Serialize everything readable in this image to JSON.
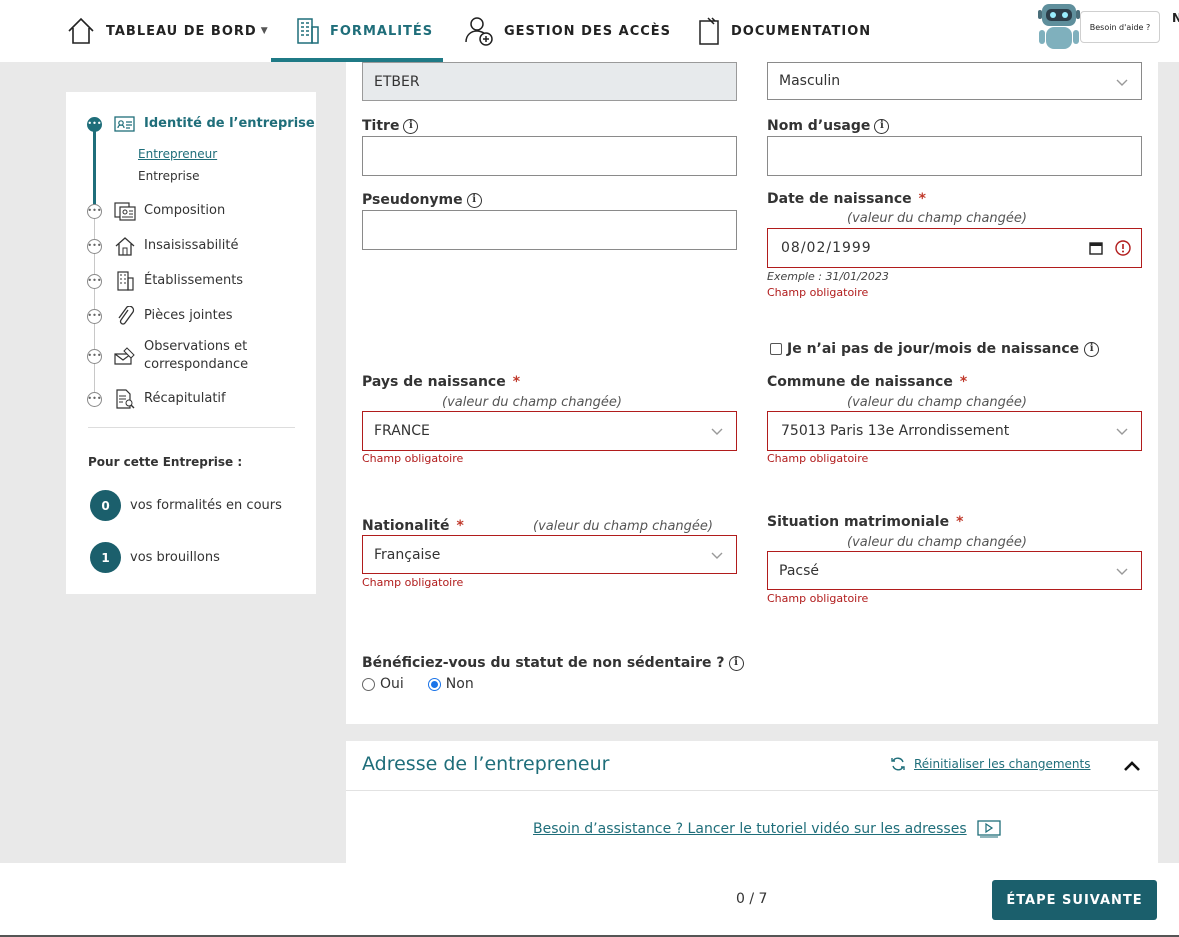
{
  "nav": {
    "items": [
      {
        "label": "TABLEAU DE BORD",
        "icon": "home-icon"
      },
      {
        "label": "FORMALITÉS",
        "icon": "building-icon",
        "active": true
      },
      {
        "label": "GESTION DES ACCÈS",
        "icon": "user-add-icon"
      },
      {
        "label": "DOCUMENTATION",
        "icon": "document-icon"
      }
    ],
    "help_label": "Besoin d'aide ?",
    "user_initial": "N"
  },
  "sidebar": {
    "steps": [
      {
        "label": "Identité de l’entreprise",
        "icon": "id-card-icon",
        "active": true
      },
      {
        "label": "Composition",
        "icon": "composition-icon"
      },
      {
        "label": "Insaisissabilité",
        "icon": "house-icon"
      },
      {
        "label": "Établissements",
        "icon": "establishment-icon"
      },
      {
        "label": "Pièces jointes",
        "icon": "paperclip-icon"
      },
      {
        "label": "Observations et correspondance",
        "icon": "envelope-icon"
      },
      {
        "label": "Récapitulatif",
        "icon": "summary-icon"
      }
    ],
    "substeps": [
      {
        "label": "Entrepreneur",
        "current": true
      },
      {
        "label": "Entreprise"
      }
    ],
    "for_title": "Pour cette Entreprise :",
    "counters": [
      {
        "value": "0",
        "label": "vos formalités en cours"
      },
      {
        "value": "1",
        "label": "vos brouillons"
      }
    ]
  },
  "form": {
    "lastname_value": "ETBER",
    "gender_value": "Masculin",
    "titre_label": "Titre",
    "nom_usage_label": "Nom d’usage",
    "pseudonyme_label": "Pseudonyme",
    "birthdate_label": "Date de naissance",
    "birthdate_value": "08/02/1999",
    "birthdate_example": "Exemple : 31/01/2023",
    "no_day_month_label": "Je n’ai pas de jour/mois de naissance",
    "birth_country_label": "Pays de naissance",
    "birth_country_value": "FRANCE",
    "birth_city_label": "Commune de naissance",
    "birth_city_value": "75013 Paris 13e Arrondissement",
    "nationality_label": "Nationalité",
    "nationality_value": "Française",
    "marital_label": "Situation matrimoniale",
    "marital_value": "Pacsé",
    "changed_text": "(valeur du champ changée)",
    "required_error": "Champ obligatoire",
    "required_mark": "*",
    "non_sedentary_label": "Bénéficiez-vous du statut de non sédentaire ?",
    "radio_oui": "Oui",
    "radio_non": "Non",
    "radio_selected": "Non"
  },
  "address": {
    "title": "Adresse de l’entrepreneur",
    "reset_label": "Réinitialiser les changements",
    "assist_label": "Besoin d’assistance ? Lancer le tutoriel vidéo sur les adresses"
  },
  "footer": {
    "progress": "0 / 7",
    "next_label": "ÉTAPE SUIVANTE"
  },
  "colors": {
    "accent": "#1f6e7a",
    "primary_button": "#1b5f6c",
    "error": "#b11c1c"
  }
}
